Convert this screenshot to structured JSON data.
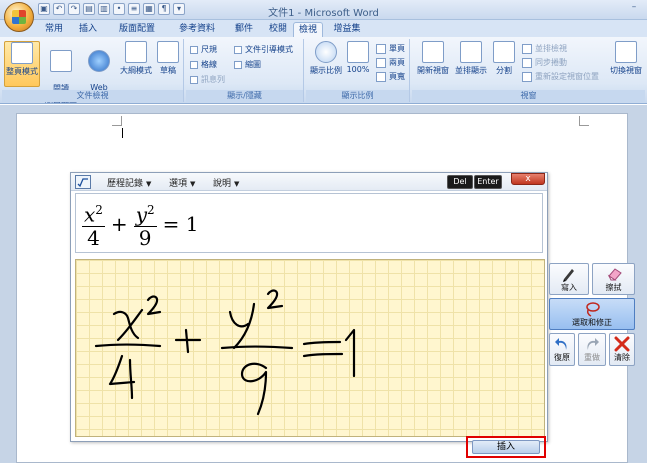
{
  "window": {
    "title": "文件1 - Microsoft Word",
    "minimize_glyph": "–"
  },
  "tabs": [
    {
      "label": "常用"
    },
    {
      "label": "插入"
    },
    {
      "label": "版面配置"
    },
    {
      "label": "參考資料"
    },
    {
      "label": "郵件"
    },
    {
      "label": "校閱"
    },
    {
      "label": "檢視",
      "active": true
    },
    {
      "label": "增益集"
    }
  ],
  "ribbon": {
    "views": {
      "label": "文件檢視",
      "buttons": [
        "整頁模式",
        "閱讀\n版面配置",
        "Web\n版面配置",
        "大綱模式",
        "草稿"
      ]
    },
    "show_hide": {
      "label": "顯示/隱藏",
      "items": [
        {
          "label": "尺規",
          "enabled": true
        },
        {
          "label": "文件引導模式",
          "enabled": true
        },
        {
          "label": "格線",
          "enabled": true
        },
        {
          "label": "縮圖",
          "enabled": true
        },
        {
          "label": "訊息列",
          "enabled": false
        }
      ]
    },
    "zoom": {
      "label": "顯示比例",
      "zoom_button": "顯示比例",
      "hundred_button": "100%",
      "single": "單頁",
      "two": "兩頁",
      "width": "頁寬"
    },
    "window": {
      "label": "視窗",
      "new_window": "開新視窗",
      "arrange_all": "並排顯示",
      "split": "分割",
      "side_by_side": "並排檢視",
      "sync_scroll": "同步捲動",
      "reset_position": "重新設定視窗位置",
      "switch_windows": "切換視窗"
    }
  },
  "math_panel": {
    "menus": {
      "history": "歷程記錄",
      "options": "選項",
      "help": "說明"
    },
    "keys": {
      "del": "Del",
      "enter": "Enter"
    },
    "close_glyph": "x",
    "formula": {
      "n1": "x",
      "e1": "2",
      "d1": "4",
      "plus": "+",
      "n2": "y",
      "e2": "2",
      "d2": "9",
      "eq": "= 1"
    },
    "tools": {
      "write": "寫入",
      "erase": "擦拭",
      "select_correct": "選取和修正",
      "undo": "復原",
      "redo": "重做",
      "clear": "清除"
    },
    "insert": "插入"
  },
  "colors": {
    "accent": "#15428b",
    "pad_bg": "#fff6cf",
    "insert_highlight": "#e00000",
    "clear_icon": "#d42a1a"
  }
}
